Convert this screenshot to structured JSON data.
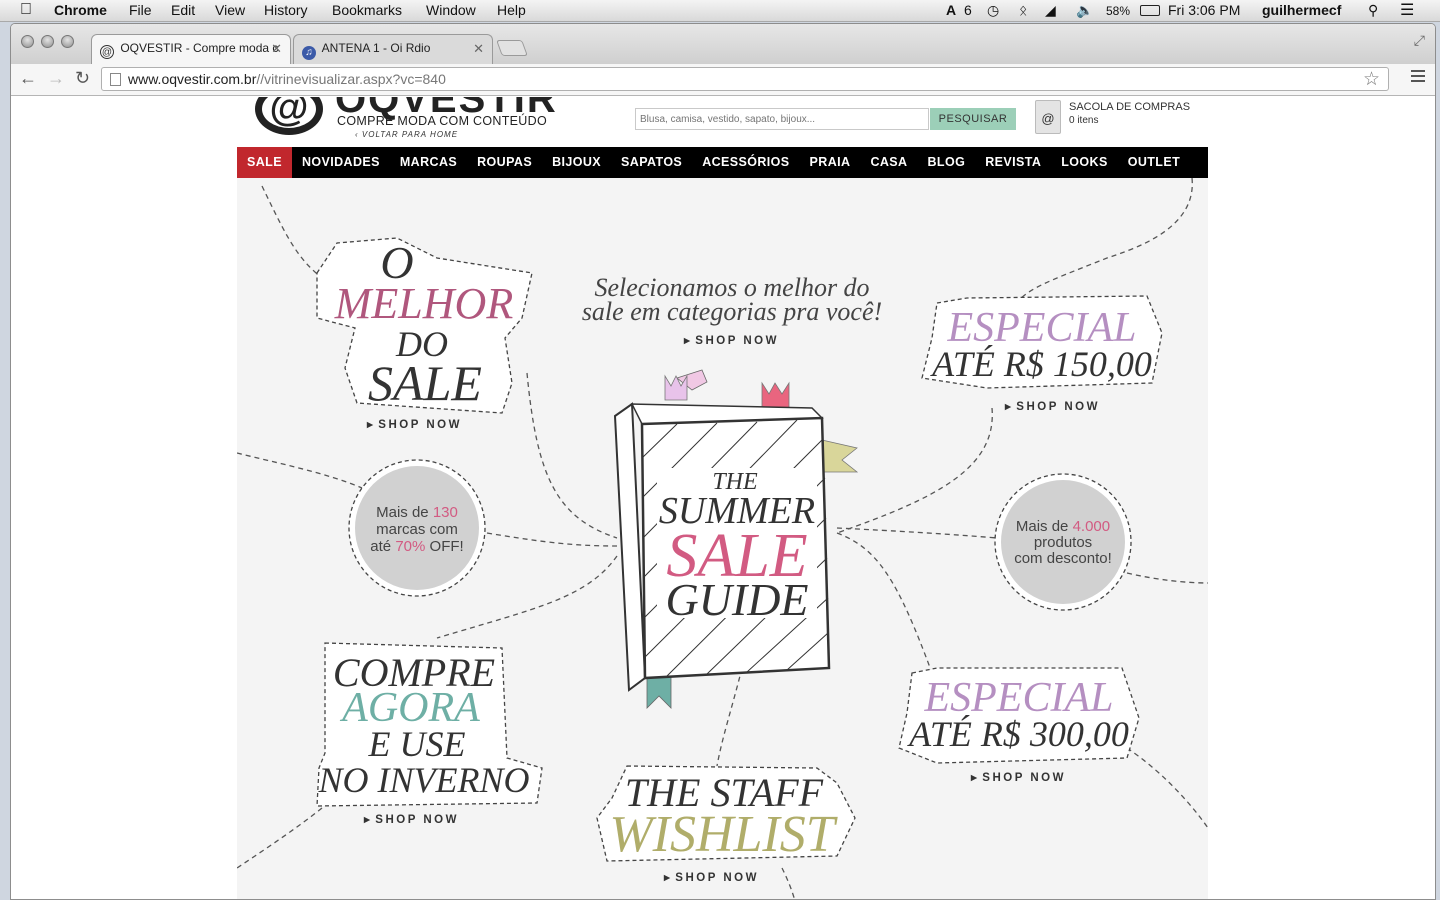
{
  "menubar": {
    "app_name": "Chrome",
    "menus": [
      "File",
      "Edit",
      "View",
      "History",
      "Bookmarks",
      "Window",
      "Help"
    ],
    "adobe_badge": "6",
    "battery": "58%",
    "clock": "Fri 3:06 PM",
    "user": "guilhermecf"
  },
  "tabs": [
    {
      "title": "OQVESTIR - Compre moda c",
      "favicon": "@"
    },
    {
      "title": "ANTENA 1 - Oi Rdio",
      "favicon": "♫"
    }
  ],
  "address": {
    "domain": "www.oqvestir.com.br",
    "path": "//vitrinevisualizar.aspx?vc=840"
  },
  "header": {
    "brand": "OQVESTIR",
    "logo_symbol": "@",
    "tagline": "COMPRE MODA COM CONTEÚDO",
    "back_home": "‹ VOLTAR PARA HOME",
    "search_placeholder": "Blusa, camisa, vestido, sapato, bijoux...",
    "search_button": "PESQUISAR",
    "bag_title": "SACOLA DE COMPRAS",
    "bag_count": "0 itens"
  },
  "nav": [
    "SALE",
    "NOVIDADES",
    "MARCAS",
    "ROUPAS",
    "BIJOUX",
    "SAPATOS",
    "ACESSÓRIOS",
    "PRAIA",
    "CASA",
    "BLOG",
    "REVISTA",
    "LOOKS",
    "OUTLET"
  ],
  "hero": {
    "intro_line1": "Selecionamos o melhor do",
    "intro_line2": "sale em categorias pra você!",
    "shop_now": "SHOP NOW",
    "book": {
      "line1": "THE",
      "line2": "SUMMER",
      "line3": "SALE",
      "line4": "GUIDE"
    },
    "melhor": {
      "line1": "O",
      "line2": "MELHOR",
      "line3": "DO",
      "line4": "SALE"
    },
    "especial150": {
      "line1": "ESPECIAL",
      "line2": "ATÉ R$ 150,00"
    },
    "especial300": {
      "line1": "ESPECIAL",
      "line2": "ATÉ R$ 300,00"
    },
    "circle_brands": {
      "a": "Mais de ",
      "b": "130",
      "c": "marcas com",
      "d": "até ",
      "e": "70%",
      "f": " OFF!"
    },
    "circle_products": {
      "a": "Mais de ",
      "b": "4.000",
      "c": "produtos",
      "d": "com desconto!"
    },
    "compre": {
      "line1": "COMPRE",
      "line2": "AGORA",
      "line3": "E USE",
      "line4": "NO INVERNO"
    },
    "staff": {
      "line1": "THE STAFF",
      "line2": "WISHLIST"
    }
  },
  "colors": {
    "pink": "#b0577d",
    "lilac": "#b58fc1",
    "teal": "#6eafa5",
    "olive": "#b0ad6a",
    "sale_red": "#c1272d",
    "nav_bg": "#000000"
  }
}
